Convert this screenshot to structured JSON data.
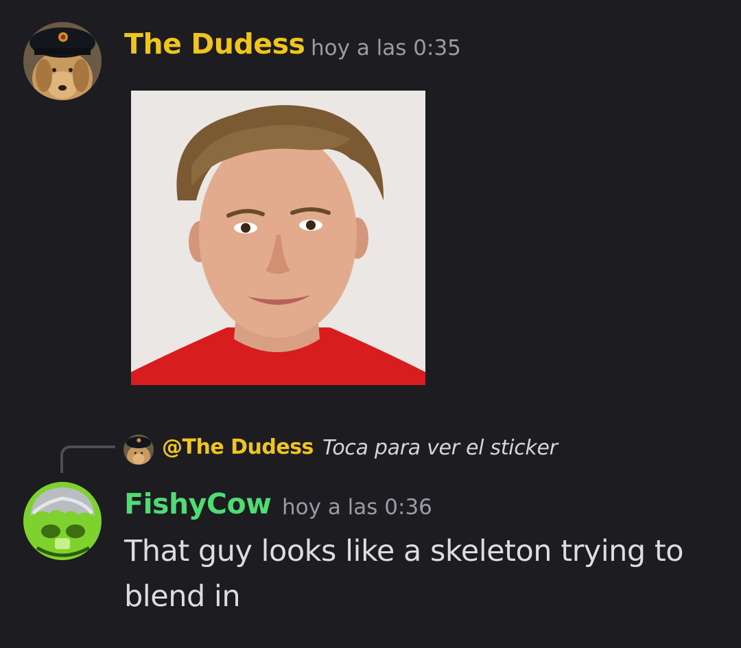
{
  "messages": [
    {
      "author": "The Dudess",
      "timestamp": "hoy a las 0:35",
      "author_color": "#f0c51c",
      "avatar": "dog-with-hat-avatar",
      "attachment": "portrait-photo"
    },
    {
      "author": "FishyCow",
      "timestamp": "hoy a las 0:36",
      "author_color": "#4fdc73",
      "avatar": "green-creature-avatar",
      "reply": {
        "mention": "@The Dudess",
        "preview": "Toca para ver el sticker"
      },
      "text": "That guy looks like a skeleton trying to blend in"
    }
  ]
}
